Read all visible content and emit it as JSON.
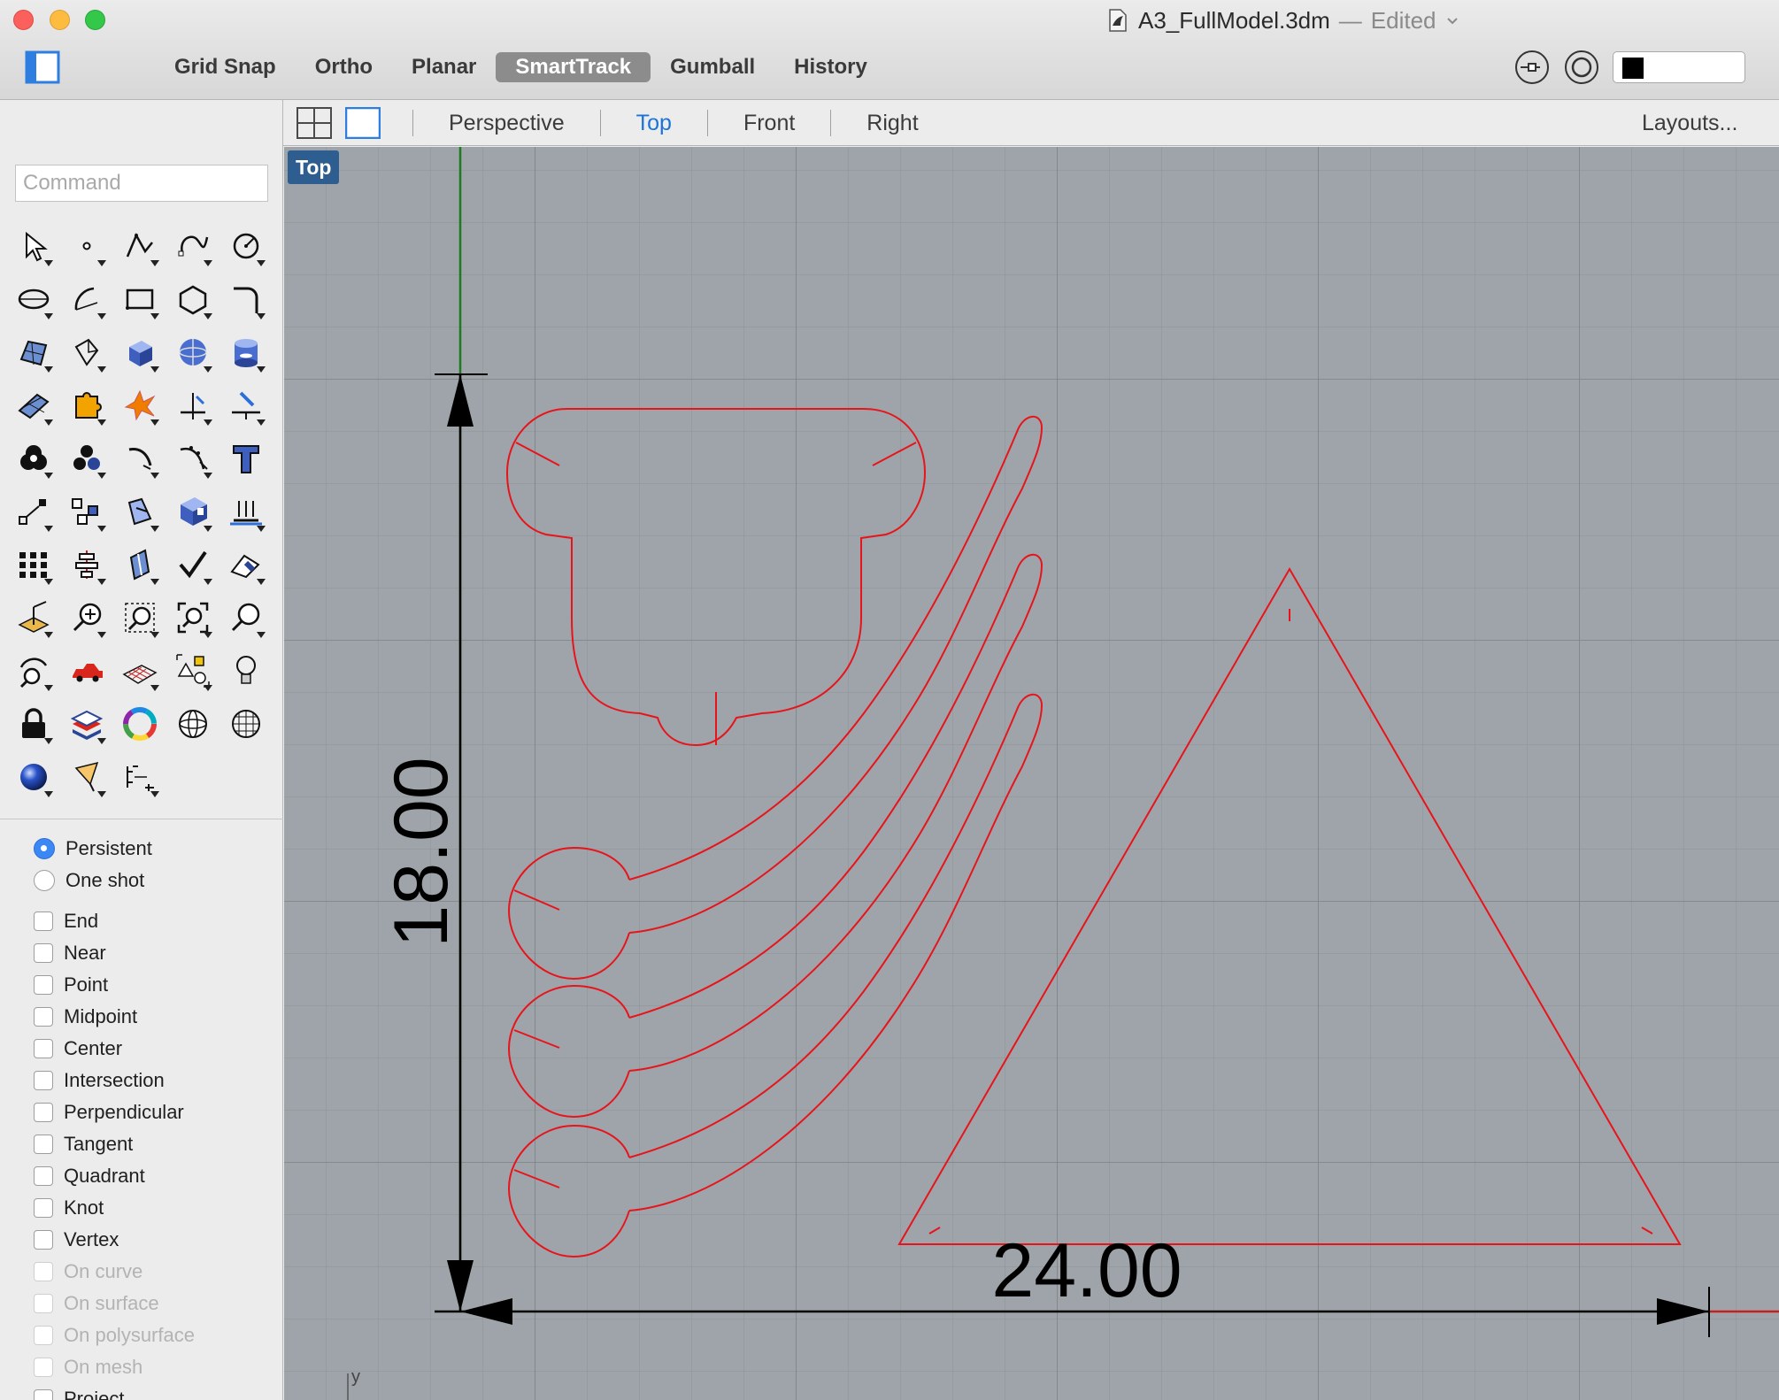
{
  "window": {
    "file_name": "A3_FullModel.3dm",
    "separator": "—",
    "status": "Edited"
  },
  "toolbar": {
    "modes": [
      {
        "label": "Grid Snap",
        "active": false
      },
      {
        "label": "Ortho",
        "active": false
      },
      {
        "label": "Planar",
        "active": false
      },
      {
        "label": "SmartTrack",
        "active": true
      },
      {
        "label": "Gumball",
        "active": false
      },
      {
        "label": "History",
        "active": false
      }
    ]
  },
  "command": {
    "placeholder": "Command"
  },
  "tools": [
    "select-arrow-icon",
    "point-icon",
    "polyline-icon",
    "curve-icon",
    "circle-icon",
    "ellipse-icon",
    "arc-icon",
    "rectangle-icon",
    "polygon-icon",
    "fillet-curve-icon",
    "surface-from-points-icon",
    "extrude-surface-icon",
    "box-solid-icon",
    "sphere-solid-icon",
    "cylinder-solid-icon",
    "mesh-plane-icon",
    "join-puzzle-icon",
    "explode-icon",
    "trim-icon",
    "split-icon",
    "boolean-union-icon",
    "boolean-split-icon",
    "fillet-edge-icon",
    "blend-curve-icon",
    "text-tool-icon",
    "move-transform-icon",
    "array-icon",
    "scale-icon",
    "shell-box-icon",
    "project-to-plane-icon",
    "grid-array-icon",
    "align-icon",
    "extrude-crv-icon",
    "check-icon",
    "analyze-direction-icon",
    "cplane-icon",
    "zoom-in-icon",
    "zoom-window-icon",
    "zoom-extents-icon",
    "zoom-icon",
    "rotate-view-icon",
    "car-render-icon",
    "mesh-grid-icon",
    "group-shapes-icon",
    "light-bulb-icon",
    "lock-icon",
    "layer-stack-icon",
    "color-wheel-icon",
    "wireframe-sphere-icon",
    "mesh-sphere-icon",
    "render-sphere-icon",
    "camera-target-icon",
    "dimension-icon"
  ],
  "osnaps": {
    "mode_options": [
      {
        "label": "Persistent",
        "selected": true
      },
      {
        "label": "One shot",
        "selected": false
      }
    ],
    "items": [
      {
        "label": "End",
        "enabled": true
      },
      {
        "label": "Near",
        "enabled": true
      },
      {
        "label": "Point",
        "enabled": true
      },
      {
        "label": "Midpoint",
        "enabled": true
      },
      {
        "label": "Center",
        "enabled": true
      },
      {
        "label": "Intersection",
        "enabled": true
      },
      {
        "label": "Perpendicular",
        "enabled": true
      },
      {
        "label": "Tangent",
        "enabled": true
      },
      {
        "label": "Quadrant",
        "enabled": true
      },
      {
        "label": "Knot",
        "enabled": true
      },
      {
        "label": "Vertex",
        "enabled": true
      },
      {
        "label": "On curve",
        "enabled": false
      },
      {
        "label": "On surface",
        "enabled": false
      },
      {
        "label": "On polysurface",
        "enabled": false
      },
      {
        "label": "On mesh",
        "enabled": false
      },
      {
        "label": "Project",
        "enabled": true
      }
    ]
  },
  "viewports": {
    "tabs": [
      {
        "label": "Perspective",
        "active": false
      },
      {
        "label": "Top",
        "active": true
      },
      {
        "label": "Front",
        "active": false
      },
      {
        "label": "Right",
        "active": false
      }
    ],
    "layouts_label": "Layouts...",
    "active_label": "Top"
  },
  "drawing": {
    "vertical_dimension": "18.00",
    "horizontal_dimension": "24.00",
    "axis_label": "y",
    "curve_color": "#e8141b",
    "dimension_color": "#000000",
    "y_axis_color": "#1f7a1f",
    "x_axis_color": "#c42020"
  },
  "colors": {
    "viewport_bg": "#9ea4a9",
    "accent": "#1a73d9",
    "viewport_label_bg": "#2e5d8f"
  }
}
